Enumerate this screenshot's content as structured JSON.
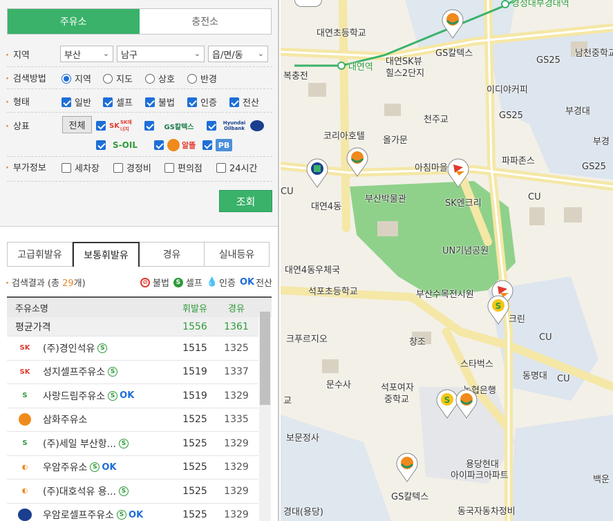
{
  "main_tabs": [
    "주유소",
    "충전소"
  ],
  "filters": {
    "region_label": "지역",
    "region": {
      "city": "부산",
      "district": "남구",
      "town": "읍/면/동"
    },
    "method_label": "검색방법",
    "methods": [
      "지역",
      "지도",
      "상호",
      "반경"
    ],
    "type_label": "형태",
    "types": [
      "일반",
      "셀프",
      "불법",
      "인증",
      "전산"
    ],
    "brand_label": "상표",
    "brand_all": "전체",
    "brands": [
      "SK에너지",
      "GS칼텍스",
      "Hyundai Oilbank",
      "S-OIL",
      "알뜰",
      "PB"
    ],
    "extra_label": "부가정보",
    "extras": [
      "세차장",
      "경정비",
      "편의점",
      "24시간"
    ],
    "search_button": "조회"
  },
  "fuel_tabs": [
    "고급휘발유",
    "보통휘발유",
    "경유",
    "실내등유"
  ],
  "results": {
    "prefix": "검색결과 (총 ",
    "count": "29",
    "suffix": "개)",
    "legend": [
      "불법",
      "셀프",
      "인증",
      "전산"
    ]
  },
  "table": {
    "headers": [
      "주유소명",
      "휘발유",
      "경유"
    ],
    "average": {
      "name": "평균가격",
      "gasoline": "1556",
      "diesel": "1361"
    },
    "rows": [
      {
        "brand": "SK",
        "name": "(주)경인석유",
        "gasoline": "1515",
        "diesel": "1325",
        "self": true,
        "ok": false
      },
      {
        "brand": "SK",
        "name": "성지셀프주유소",
        "gasoline": "1519",
        "diesel": "1337",
        "self": true,
        "ok": false
      },
      {
        "brand": "S-OIL",
        "name": "사랑드림주유소",
        "gasoline": "1519",
        "diesel": "1329",
        "self": true,
        "ok": true
      },
      {
        "brand": "알뜰",
        "name": "삼화주유소",
        "gasoline": "1525",
        "diesel": "1335",
        "self": false,
        "ok": false
      },
      {
        "brand": "S-OIL",
        "name": "(주)세일 부산항...",
        "gasoline": "1525",
        "diesel": "1329",
        "self": true,
        "ok": false
      },
      {
        "brand": "GS",
        "name": "우암주유소",
        "gasoline": "1525",
        "diesel": "1329",
        "self": true,
        "ok": true
      },
      {
        "brand": "GS",
        "name": "(주)대호석유 용...",
        "gasoline": "1525",
        "diesel": "1329",
        "self": true,
        "ok": false
      },
      {
        "brand": "HD",
        "name": "우암로셀프주유소",
        "gasoline": "1525",
        "diesel": "1329",
        "self": true,
        "ok": true
      }
    ]
  },
  "map": {
    "labels": [
      "경성대부경대역",
      "대연초등학교",
      "GS칼텍스",
      "남천중학교",
      "복충전",
      "대연역",
      "대연SK뷰",
      "힐스2단지",
      "GS25",
      "이디야커피",
      "부경대",
      "천주교",
      "GS25",
      "부경",
      "코리아호텔",
      "올가문",
      "파파존스",
      "아침마을",
      "GS25",
      "대연4동",
      "부산박물관",
      "SK엔크리",
      "CU",
      "CU",
      "UN기념공원",
      "대연4동우체국",
      "석포초등학교",
      "부산수목전시원",
      "크푸르지오",
      "창조",
      "스타벅스",
      "동명대",
      "CU",
      "CU",
      "문수사",
      "석포여자",
      "중학교",
      "농협은행",
      "보문정사",
      "용당현대",
      "아이파크아파트",
      "GS칼텍스",
      "동국자동차정비",
      "백운",
      "경대(용당)",
      "교",
      "크린"
    ]
  },
  "colors": {
    "accent_green": "#3ab26a",
    "orange": "#e58b2b",
    "blue": "#1d6ed8"
  }
}
